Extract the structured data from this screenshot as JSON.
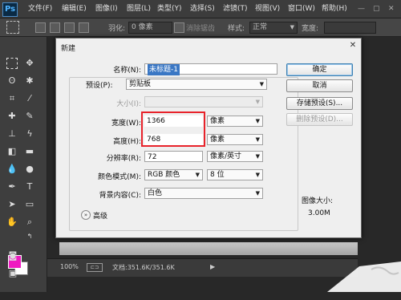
{
  "app": {
    "logo": "Ps"
  },
  "menu": {
    "items": [
      "文件(F)",
      "编辑(E)",
      "图像(I)",
      "图层(L)",
      "类型(Y)",
      "选择(S)",
      "滤镜(T)",
      "视图(V)",
      "窗口(W)",
      "帮助(H)"
    ]
  },
  "options_bar": {
    "feather_label": "羽化:",
    "feather_value": "0 像素",
    "antialias_label": "消除锯齿",
    "style_label": "样式:",
    "style_value": "正常",
    "width_label": "宽度:"
  },
  "dialog": {
    "title": "新建",
    "name_label": "名称(N):",
    "name_value": "未标题-1",
    "preset_label": "预设(P):",
    "preset_value": "剪贴板",
    "size_label": "大小(I):",
    "width_label": "宽度(W):",
    "width_value": "1366",
    "width_unit": "像素",
    "height_label": "高度(H):",
    "height_value": "768",
    "height_unit": "像素",
    "resolution_label": "分辨率(R):",
    "resolution_value": "72",
    "resolution_unit": "像素/英寸",
    "color_mode_label": "颜色模式(M):",
    "color_mode_value": "RGB 颜色",
    "bit_depth_value": "8 位",
    "background_label": "背景内容(C):",
    "background_value": "白色",
    "advanced_label": "高级",
    "buttons": {
      "ok": "确定",
      "cancel": "取消",
      "save_preset": "存储预设(S)...",
      "delete_preset": "删除预设(D)..."
    },
    "image_size_label": "图像大小:",
    "image_size_value": "3.00M"
  },
  "status_bar": {
    "zoom": "100%",
    "doc_info": "文档:351.6K/351.6K"
  },
  "colors": {
    "foreground": "#ef1ac1",
    "background": "#ffffff",
    "highlight": "#e8232b"
  }
}
